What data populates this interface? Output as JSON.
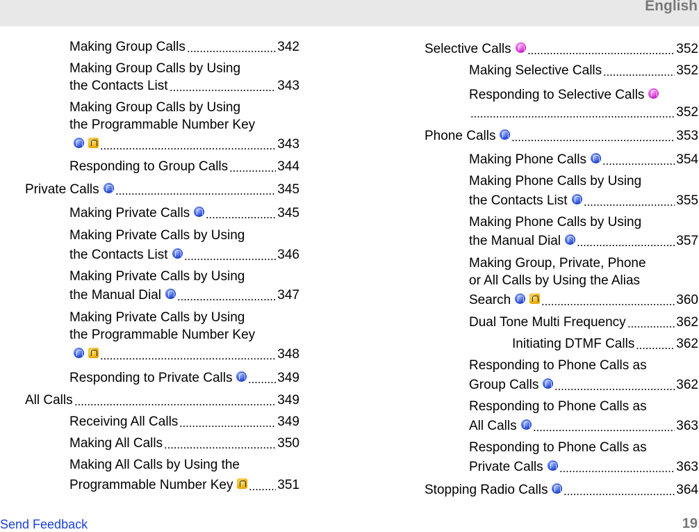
{
  "header": {
    "language": "English"
  },
  "footer": {
    "feedback_link": "Send Feedback",
    "page_number": "19"
  },
  "toc": [
    {
      "lines": [
        {
          "text": "Making Group Calls"
        }
      ],
      "page": "342"
    },
    {
      "lines": [
        {
          "text": "Making Group Calls by Using"
        },
        {
          "text": "the Contacts List"
        }
      ],
      "page": "343"
    },
    {
      "lines": [
        {
          "text": "Making Group Calls by Using"
        },
        {
          "text": "the Programmable Number Key"
        },
        {
          "text": "",
          "icons": [
            "blue",
            "yellow"
          ]
        }
      ],
      "page": "343"
    },
    {
      "lines": [
        {
          "text": "Responding to Group Calls"
        }
      ],
      "page": "344"
    },
    {
      "lines": [
        {
          "text": "Private Calls",
          "icons": [
            "blue"
          ]
        }
      ],
      "page": "345"
    },
    {
      "lines": [
        {
          "text": "Making Private Calls",
          "icons": [
            "blue"
          ]
        }
      ],
      "page": "345"
    },
    {
      "lines": [
        {
          "text": "Making Private Calls by Using"
        },
        {
          "text": "the Contacts List",
          "icons": [
            "blue"
          ]
        }
      ],
      "page": "346"
    },
    {
      "lines": [
        {
          "text": "Making Private Calls by Using"
        },
        {
          "text": "the Manual Dial",
          "icons": [
            "blue"
          ]
        }
      ],
      "page": "347"
    },
    {
      "lines": [
        {
          "text": "Making Private Calls by Using"
        },
        {
          "text": "the Programmable Number Key"
        },
        {
          "text": "",
          "icons": [
            "blue",
            "yellow"
          ]
        }
      ],
      "page": "348"
    },
    {
      "lines": [
        {
          "text": "Responding to Private Calls",
          "icons": [
            "blue"
          ]
        }
      ],
      "page": "349"
    },
    {
      "lines": [
        {
          "text": "All Calls"
        }
      ],
      "page": "349"
    },
    {
      "lines": [
        {
          "text": "Receiving All Calls"
        }
      ],
      "page": "349"
    },
    {
      "lines": [
        {
          "text": "Making All Calls"
        }
      ],
      "page": "350"
    },
    {
      "lines": [
        {
          "text": "Making All Calls by Using the"
        },
        {
          "text": "Programmable Number Key",
          "icons": [
            "yellow"
          ]
        }
      ],
      "page": "351"
    },
    {
      "lines": [
        {
          "text": "Selective Calls",
          "icons": [
            "pink"
          ]
        }
      ],
      "page": "352"
    },
    {
      "lines": [
        {
          "text": "Making Selective Calls"
        }
      ],
      "page": "352"
    },
    {
      "lines": [
        {
          "text": "Responding to Selective Calls",
          "icons": [
            "pink"
          ]
        },
        {
          "text": ""
        }
      ],
      "page": "352"
    },
    {
      "lines": [
        {
          "text": "Phone Calls",
          "icons": [
            "blue"
          ]
        }
      ],
      "page": "353"
    },
    {
      "lines": [
        {
          "text": "Making Phone Calls",
          "icons": [
            "blue"
          ]
        }
      ],
      "page": "354"
    },
    {
      "lines": [
        {
          "text": "Making Phone Calls by Using"
        },
        {
          "text": "the Contacts List",
          "icons": [
            "blue"
          ]
        }
      ],
      "page": "355"
    },
    {
      "lines": [
        {
          "text": "Making Phone Calls by Using"
        },
        {
          "text": "the Manual Dial",
          "icons": [
            "blue"
          ]
        }
      ],
      "page": "357"
    },
    {
      "lines": [
        {
          "text": "Making Group, Private, Phone"
        },
        {
          "text": "or All Calls by Using the Alias"
        },
        {
          "text": "Search",
          "icons": [
            "blue",
            "yellow"
          ]
        }
      ],
      "page": "360"
    },
    {
      "lines": [
        {
          "text": "Dual Tone Multi Frequency"
        }
      ],
      "page": "362"
    },
    {
      "lines": [
        {
          "text": "Initiating DTMF Calls"
        }
      ],
      "page": "362"
    },
    {
      "lines": [
        {
          "text": "Responding to Phone Calls as"
        },
        {
          "text": "Group Calls",
          "icons": [
            "blue"
          ]
        }
      ],
      "page": "362"
    },
    {
      "lines": [
        {
          "text": "Responding to Phone Calls as"
        },
        {
          "text": "All Calls",
          "icons": [
            "blue"
          ]
        }
      ],
      "page": "363"
    },
    {
      "lines": [
        {
          "text": "Responding to Phone Calls as"
        },
        {
          "text": "Private Calls",
          "icons": [
            "blue"
          ]
        }
      ],
      "page": "363"
    },
    {
      "lines": [
        {
          "text": "Stopping Radio Calls",
          "icons": [
            "blue"
          ]
        }
      ],
      "page": "364"
    }
  ]
}
